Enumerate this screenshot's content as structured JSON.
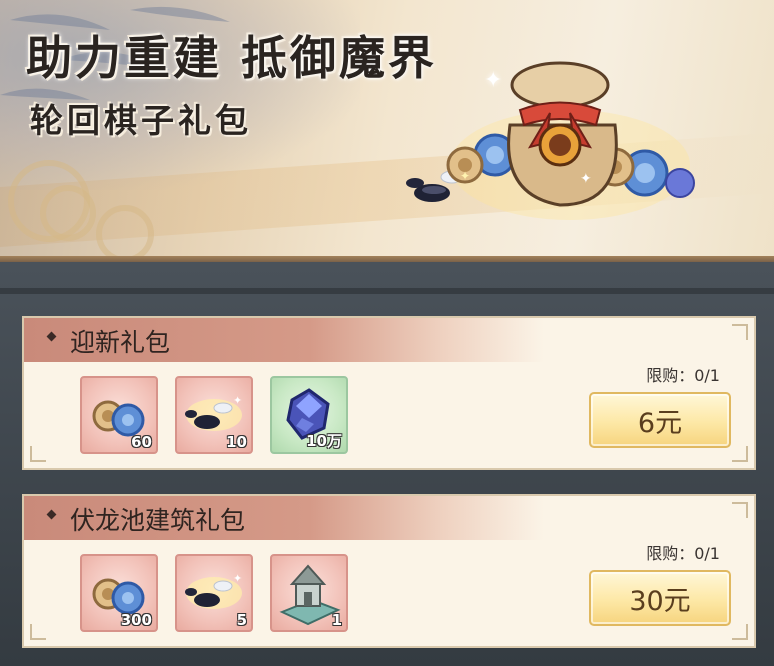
{
  "banner": {
    "title": "助力重建 抵御魔界",
    "subtitle": "轮回棋子礼包"
  },
  "packs": [
    {
      "title": "迎新礼包",
      "limit_label": "限购：0/1",
      "price": "6元",
      "items": [
        {
          "icon": "shell-snail-icon",
          "qty": "60"
        },
        {
          "icon": "chess-pieces-icon",
          "qty": "10"
        },
        {
          "icon": "blue-gem-icon",
          "qty": "10万"
        }
      ]
    },
    {
      "title": "伏龙池建筑礼包",
      "limit_label": "限购：0/1",
      "price": "30元",
      "items": [
        {
          "icon": "shell-snail-icon",
          "qty": "300"
        },
        {
          "icon": "chess-pieces-icon",
          "qty": "5"
        },
        {
          "icon": "building-icon",
          "qty": "1"
        }
      ]
    }
  ],
  "colors": {
    "card_bg": "#fbf4e7",
    "header_wash": "#c98a7a",
    "price_button": "#fde8a6",
    "item_frame_red": "#d7938a",
    "item_frame_green": "#9cc7a0"
  }
}
